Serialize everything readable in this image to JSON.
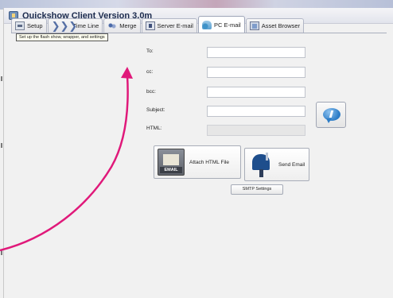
{
  "window": {
    "title": "Quickshow Client Version 3.0m"
  },
  "tabs": [
    {
      "label": "Setup",
      "icon": "setup-icon"
    },
    {
      "label": "Time Line",
      "icon": "timeline-icon"
    },
    {
      "label": "Merge",
      "icon": "merge-icon"
    },
    {
      "label": "Server E-mail",
      "icon": "server-email-icon"
    },
    {
      "label": "PC E-mail",
      "icon": "pc-email-icon",
      "active": true
    },
    {
      "label": "Asset Browser",
      "icon": "asset-browser-icon"
    }
  ],
  "tooltip": "Set up the flash show, wrapper, and settings",
  "form": {
    "to_label": "To:",
    "cc_label": "cc:",
    "bcc_label": "bcc:",
    "subject_label": "Subject:",
    "html_label": "HTML:",
    "to_value": "",
    "cc_value": "",
    "bcc_value": "",
    "subject_value": "",
    "html_value": ""
  },
  "buttons": {
    "attach_label": "Attach HTML File",
    "attach_icon_tag": "EMAIL",
    "send_label": "Send Email",
    "smtp_label": "SMTP Settings"
  },
  "colors": {
    "annotation_arrow": "#e0197a"
  }
}
